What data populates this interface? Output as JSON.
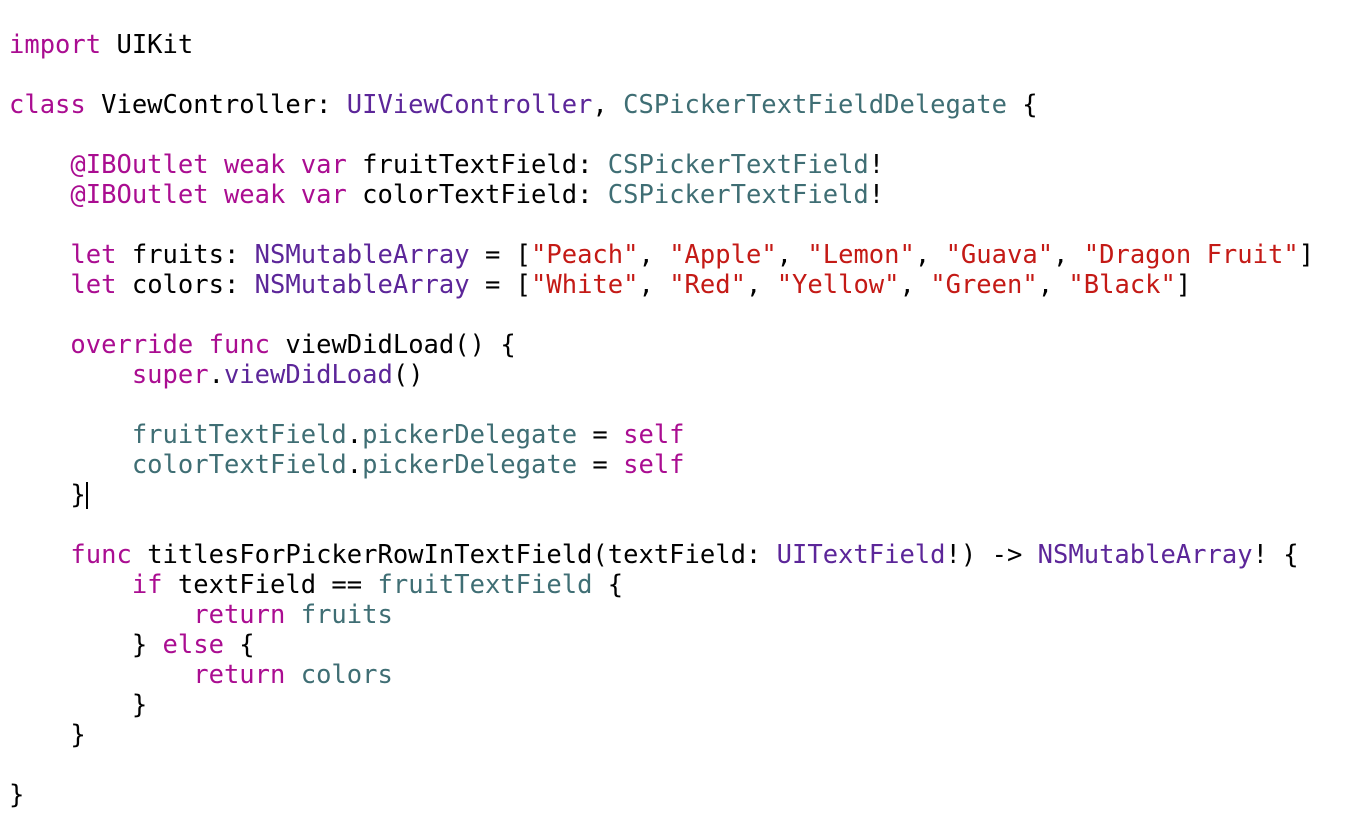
{
  "editor": {
    "colors": {
      "background": "#ffffff",
      "plain": "#000000",
      "keyword": "#aa0d91",
      "system_type": "#5c2699",
      "project_symbol": "#3f6e74",
      "string": "#c41a16"
    },
    "caret_line": 15,
    "lines": [
      [
        {
          "t": "kw",
          "v": "import"
        },
        {
          "t": "plain",
          "v": " UIKit"
        }
      ],
      [],
      [
        {
          "t": "kw",
          "v": "class"
        },
        {
          "t": "plain",
          "v": " ViewController: "
        },
        {
          "t": "type",
          "v": "UIViewController"
        },
        {
          "t": "plain",
          "v": ", "
        },
        {
          "t": "proj",
          "v": "CSPickerTextFieldDelegate"
        },
        {
          "t": "plain",
          "v": " {"
        }
      ],
      [],
      [
        {
          "t": "plain",
          "v": "    "
        },
        {
          "t": "kw",
          "v": "@IBOutlet"
        },
        {
          "t": "plain",
          "v": " "
        },
        {
          "t": "kw",
          "v": "weak"
        },
        {
          "t": "plain",
          "v": " "
        },
        {
          "t": "kw",
          "v": "var"
        },
        {
          "t": "plain",
          "v": " fruitTextField: "
        },
        {
          "t": "proj",
          "v": "CSPickerTextField"
        },
        {
          "t": "plain",
          "v": "!"
        }
      ],
      [
        {
          "t": "plain",
          "v": "    "
        },
        {
          "t": "kw",
          "v": "@IBOutlet"
        },
        {
          "t": "plain",
          "v": " "
        },
        {
          "t": "kw",
          "v": "weak"
        },
        {
          "t": "plain",
          "v": " "
        },
        {
          "t": "kw",
          "v": "var"
        },
        {
          "t": "plain",
          "v": " colorTextField: "
        },
        {
          "t": "proj",
          "v": "CSPickerTextField"
        },
        {
          "t": "plain",
          "v": "!"
        }
      ],
      [],
      [
        {
          "t": "plain",
          "v": "    "
        },
        {
          "t": "kw",
          "v": "let"
        },
        {
          "t": "plain",
          "v": " fruits: "
        },
        {
          "t": "type",
          "v": "NSMutableArray"
        },
        {
          "t": "plain",
          "v": " = ["
        },
        {
          "t": "str",
          "v": "\"Peach\""
        },
        {
          "t": "plain",
          "v": ", "
        },
        {
          "t": "str",
          "v": "\"Apple\""
        },
        {
          "t": "plain",
          "v": ", "
        },
        {
          "t": "str",
          "v": "\"Lemon\""
        },
        {
          "t": "plain",
          "v": ", "
        },
        {
          "t": "str",
          "v": "\"Guava\""
        },
        {
          "t": "plain",
          "v": ", "
        },
        {
          "t": "str",
          "v": "\"Dragon Fruit\""
        },
        {
          "t": "plain",
          "v": "]"
        }
      ],
      [
        {
          "t": "plain",
          "v": "    "
        },
        {
          "t": "kw",
          "v": "let"
        },
        {
          "t": "plain",
          "v": " colors: "
        },
        {
          "t": "type",
          "v": "NSMutableArray"
        },
        {
          "t": "plain",
          "v": " = ["
        },
        {
          "t": "str",
          "v": "\"White\""
        },
        {
          "t": "plain",
          "v": ", "
        },
        {
          "t": "str",
          "v": "\"Red\""
        },
        {
          "t": "plain",
          "v": ", "
        },
        {
          "t": "str",
          "v": "\"Yellow\""
        },
        {
          "t": "plain",
          "v": ", "
        },
        {
          "t": "str",
          "v": "\"Green\""
        },
        {
          "t": "plain",
          "v": ", "
        },
        {
          "t": "str",
          "v": "\"Black\""
        },
        {
          "t": "plain",
          "v": "]"
        }
      ],
      [],
      [
        {
          "t": "plain",
          "v": "    "
        },
        {
          "t": "kw",
          "v": "override"
        },
        {
          "t": "plain",
          "v": " "
        },
        {
          "t": "kw",
          "v": "func"
        },
        {
          "t": "plain",
          "v": " viewDidLoad() {"
        }
      ],
      [
        {
          "t": "plain",
          "v": "        "
        },
        {
          "t": "kw",
          "v": "super"
        },
        {
          "t": "plain",
          "v": "."
        },
        {
          "t": "type",
          "v": "viewDidLoad"
        },
        {
          "t": "plain",
          "v": "()"
        }
      ],
      [],
      [
        {
          "t": "plain",
          "v": "        "
        },
        {
          "t": "proj",
          "v": "fruitTextField"
        },
        {
          "t": "plain",
          "v": "."
        },
        {
          "t": "proj",
          "v": "pickerDelegate"
        },
        {
          "t": "plain",
          "v": " = "
        },
        {
          "t": "kw",
          "v": "self"
        }
      ],
      [
        {
          "t": "plain",
          "v": "        "
        },
        {
          "t": "proj",
          "v": "colorTextField"
        },
        {
          "t": "plain",
          "v": "."
        },
        {
          "t": "proj",
          "v": "pickerDelegate"
        },
        {
          "t": "plain",
          "v": " = "
        },
        {
          "t": "kw",
          "v": "self"
        }
      ],
      [
        {
          "t": "plain",
          "v": "    }"
        }
      ],
      [],
      [
        {
          "t": "plain",
          "v": "    "
        },
        {
          "t": "kw",
          "v": "func"
        },
        {
          "t": "plain",
          "v": " titlesForPickerRowInTextField(textField: "
        },
        {
          "t": "type",
          "v": "UITextField"
        },
        {
          "t": "plain",
          "v": "!) -> "
        },
        {
          "t": "type",
          "v": "NSMutableArray"
        },
        {
          "t": "plain",
          "v": "! {"
        }
      ],
      [
        {
          "t": "plain",
          "v": "        "
        },
        {
          "t": "kw",
          "v": "if"
        },
        {
          "t": "plain",
          "v": " textField == "
        },
        {
          "t": "proj",
          "v": "fruitTextField"
        },
        {
          "t": "plain",
          "v": " {"
        }
      ],
      [
        {
          "t": "plain",
          "v": "            "
        },
        {
          "t": "kw",
          "v": "return"
        },
        {
          "t": "plain",
          "v": " "
        },
        {
          "t": "proj",
          "v": "fruits"
        }
      ],
      [
        {
          "t": "plain",
          "v": "        } "
        },
        {
          "t": "kw",
          "v": "else"
        },
        {
          "t": "plain",
          "v": " {"
        }
      ],
      [
        {
          "t": "plain",
          "v": "            "
        },
        {
          "t": "kw",
          "v": "return"
        },
        {
          "t": "plain",
          "v": " "
        },
        {
          "t": "proj",
          "v": "colors"
        }
      ],
      [
        {
          "t": "plain",
          "v": "        }"
        }
      ],
      [
        {
          "t": "plain",
          "v": "    }"
        }
      ],
      [],
      [
        {
          "t": "plain",
          "v": "}"
        }
      ]
    ]
  }
}
